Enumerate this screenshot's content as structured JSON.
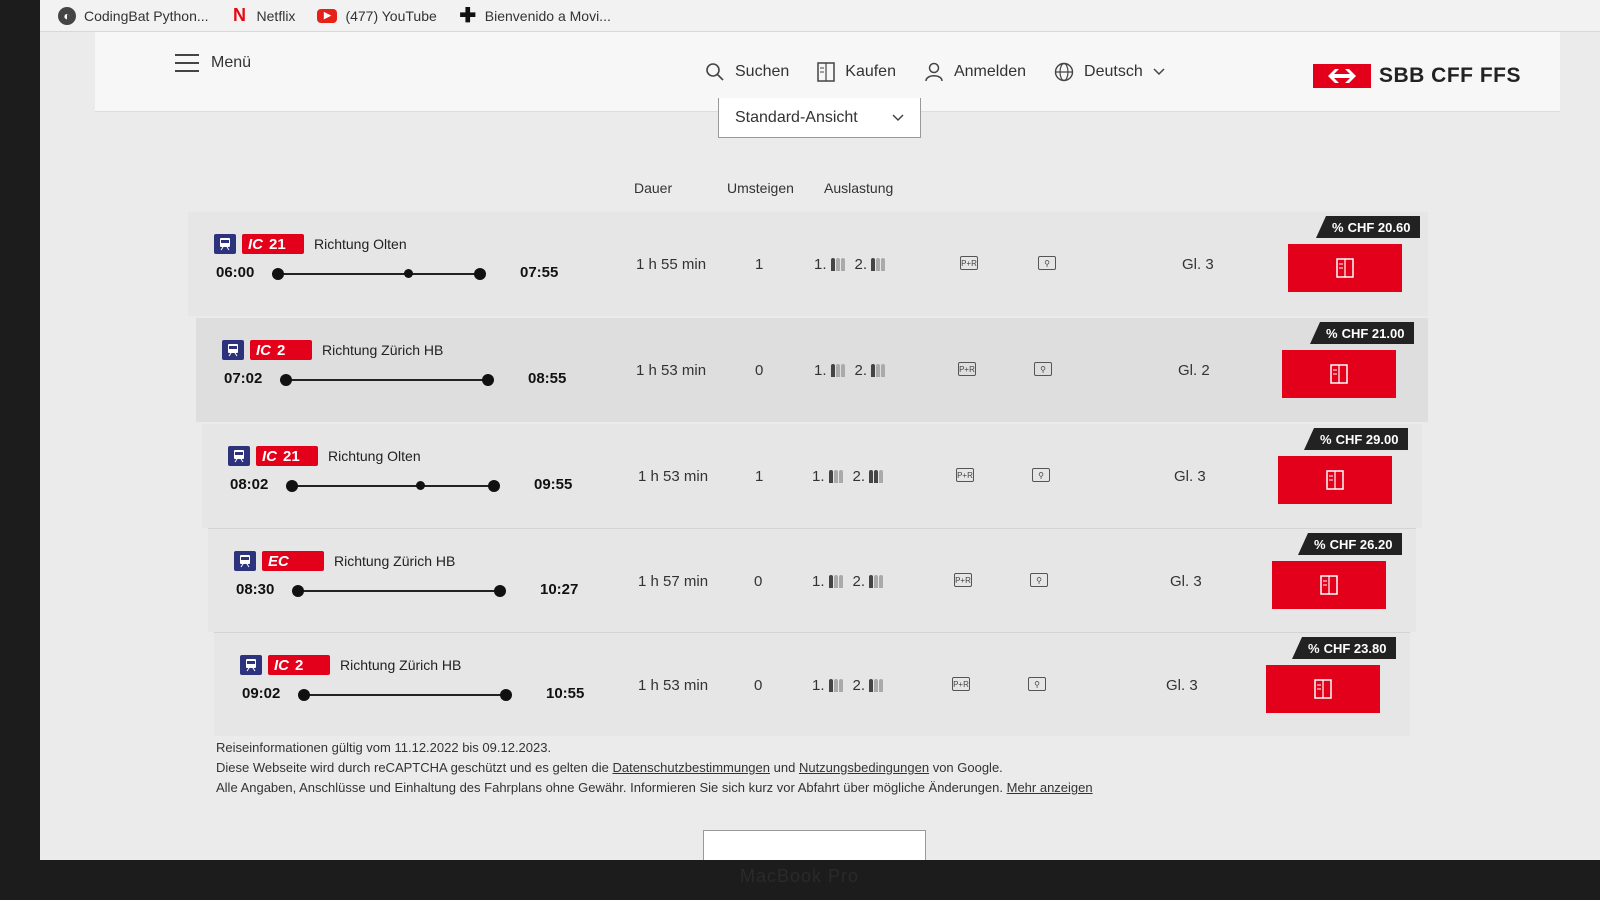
{
  "bookmarks": [
    {
      "label": "CodingBat Python...",
      "icon": "codingbat-icon"
    },
    {
      "label": "Netflix",
      "icon": "netflix-icon"
    },
    {
      "label": "(477) YouTube",
      "icon": "youtube-icon"
    },
    {
      "label": "Bienvenido a Movi...",
      "icon": "plus-icon"
    }
  ],
  "header": {
    "menu_label": "Menü",
    "nav": {
      "search": "Suchen",
      "buy": "Kaufen",
      "login": "Anmelden",
      "language": "Deutsch"
    },
    "logo_text": "SBB CFF FFS"
  },
  "view_select": {
    "value": "Standard-Ansicht"
  },
  "columns": {
    "duration": "Dauer",
    "changes": "Umsteigen",
    "occupancy": "Auslastung"
  },
  "connections": [
    {
      "product": "IC",
      "line": "21",
      "direction": "Richtung Olten",
      "dep": "06:00",
      "arr": "07:55",
      "duration": "1 h 55 min",
      "changes": "1",
      "occ1": "1.",
      "occ2": "2.",
      "pr": "P+R",
      "platform": "Gl. 3",
      "price": "CHF 20.60",
      "has_stop": true
    },
    {
      "product": "IC",
      "line": "2",
      "direction": "Richtung Zürich HB",
      "dep": "07:02",
      "arr": "08:55",
      "duration": "1 h 53 min",
      "changes": "0",
      "occ1": "1.",
      "occ2": "2.",
      "pr": "P+R",
      "platform": "Gl. 2",
      "price": "CHF 21.00",
      "has_stop": false
    },
    {
      "product": "IC",
      "line": "21",
      "direction": "Richtung Olten",
      "dep": "08:02",
      "arr": "09:55",
      "duration": "1 h 53 min",
      "changes": "1",
      "occ1": "1.",
      "occ2": "2.",
      "pr": "P+R",
      "platform": "Gl. 3",
      "price": "CHF 29.00",
      "has_stop": true
    },
    {
      "product": "EC",
      "line": "",
      "direction": "Richtung Zürich HB",
      "dep": "08:30",
      "arr": "10:27",
      "duration": "1 h 57 min",
      "changes": "0",
      "occ1": "1.",
      "occ2": "2.",
      "pr": "P+R",
      "platform": "Gl. 3",
      "price": "CHF 26.20",
      "has_stop": false
    },
    {
      "product": "IC",
      "line": "2",
      "direction": "Richtung Zürich HB",
      "dep": "09:02",
      "arr": "10:55",
      "duration": "1 h 53 min",
      "changes": "0",
      "occ1": "1.",
      "occ2": "2.",
      "pr": "P+R",
      "platform": "Gl. 3",
      "price": "CHF 23.80",
      "has_stop": false
    }
  ],
  "footer": {
    "validity": "Reiseinformationen gültig vom 11.12.2022 bis 09.12.2023.",
    "recaptcha_pre": "Diese Webseite wird durch reCAPTCHA geschützt und es gelten die",
    "privacy_link": "Datenschutzbestimmungen",
    "and": "und",
    "terms_link": "Nutzungsbedingungen",
    "recaptcha_post": "von Google.",
    "disclaimer": "Alle Angaben, Anschlüsse und Einhaltung des Fahrplans ohne Gewähr. Informieren Sie sich kurz vor Abfahrt über mögliche Änderungen.",
    "more_link": "Mehr anzeigen"
  },
  "device_label": "MacBook Pro",
  "colors": {
    "brand_red": "#e3001b",
    "train_blue": "#2d327d"
  }
}
